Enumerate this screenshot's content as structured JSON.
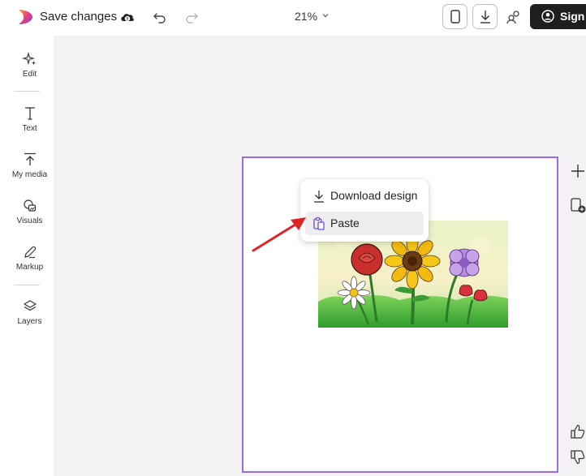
{
  "topbar": {
    "save_label": "Save changes",
    "zoom": "21%",
    "sign_label": "Sign"
  },
  "sidebar": {
    "items": [
      {
        "label": "Edit",
        "icon": "sparkle-icon"
      },
      {
        "label": "Text",
        "icon": "text-icon"
      },
      {
        "label": "My media",
        "icon": "upload-icon"
      },
      {
        "label": "Visuals",
        "icon": "shapes-icon"
      },
      {
        "label": "Markup",
        "icon": "pen-icon"
      },
      {
        "label": "Layers",
        "icon": "layers-icon"
      }
    ]
  },
  "menu": {
    "items": [
      {
        "label": "Download design",
        "icon": "download-icon"
      },
      {
        "label": "Paste",
        "icon": "clipboard-icon",
        "highlighted": true
      }
    ]
  },
  "colors": {
    "accent": "#9b6be6",
    "annotation_arrow": "#e02424",
    "sign_button": "#1e1e1e"
  }
}
